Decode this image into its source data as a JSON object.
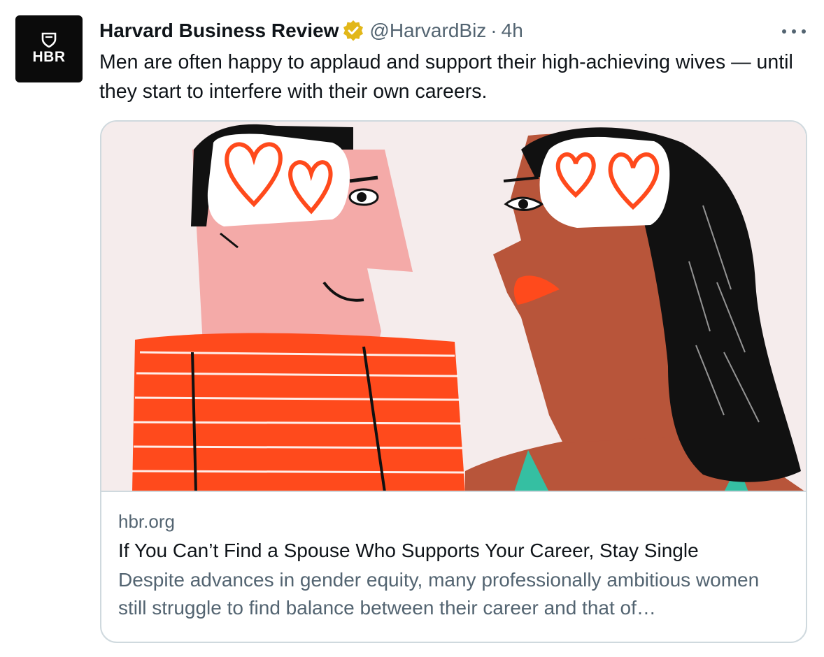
{
  "author": {
    "avatar_text": "HBR",
    "display_name": "Harvard Business Review",
    "handle": "@HarvardBiz",
    "separator": "·",
    "time": "4h",
    "verified_icon": "verified-gold-badge-icon",
    "verified_color": "#e2b719"
  },
  "tweet": {
    "text": "Men are often happy to applaud and support their high-achieving wives — until they start to interfere with their own careers."
  },
  "menu": {
    "icon": "more-horizontal-icon"
  },
  "card": {
    "image_icon": "illustration-couple-heart-eyes",
    "domain": "hbr.org",
    "title": "If You Can’t Find a Spouse Who Supports Your Career, Stay Single",
    "description": "Despite advances in gender equity, many professionally ambitious women still struggle to find balance between their career and that of…"
  },
  "colors": {
    "text_primary": "#0f1419",
    "text_secondary": "#536471",
    "border": "#cfd9de",
    "illustration_orange": "#ff4a1c",
    "illustration_pink": "#f4aaa8",
    "illustration_brown": "#b8553a",
    "illustration_teal": "#35bfa2"
  }
}
